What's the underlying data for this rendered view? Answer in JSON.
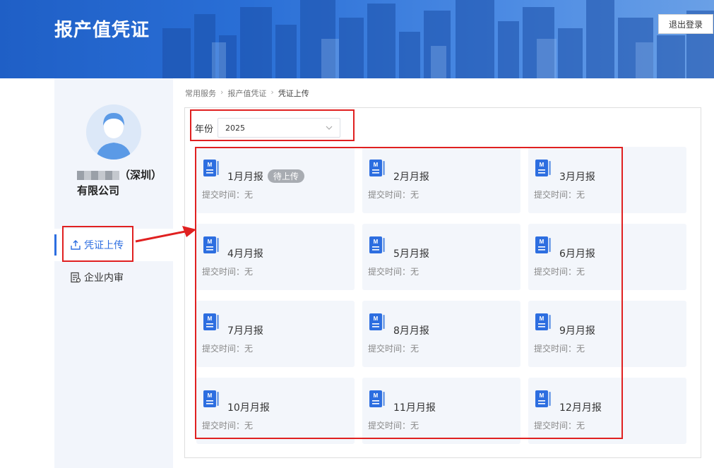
{
  "header": {
    "title": "报产值凭证",
    "logout_label": "退出登录"
  },
  "sidebar": {
    "company_name_suffix": "（深圳）有限公司",
    "items": [
      {
        "label": "凭证上传",
        "icon": "upload-icon",
        "active": true
      },
      {
        "label": "企业内审",
        "icon": "audit-doc-icon",
        "active": false
      }
    ]
  },
  "breadcrumb": [
    "常用服务",
    "报产值凭证",
    "凭证上传"
  ],
  "filter": {
    "year_label": "年份",
    "year_value": "2025"
  },
  "reports": [
    {
      "title": "1月月报",
      "badge": "待上传",
      "time_label": "提交时间：无"
    },
    {
      "title": "2月月报",
      "badge": "",
      "time_label": "提交时间：无"
    },
    {
      "title": "3月月报",
      "badge": "",
      "time_label": "提交时间：无"
    },
    {
      "title": "4月月报",
      "badge": "",
      "time_label": "提交时间：无"
    },
    {
      "title": "5月月报",
      "badge": "",
      "time_label": "提交时间：无"
    },
    {
      "title": "6月月报",
      "badge": "",
      "time_label": "提交时间：无"
    },
    {
      "title": "7月月报",
      "badge": "",
      "time_label": "提交时间：无"
    },
    {
      "title": "8月月报",
      "badge": "",
      "time_label": "提交时间：无"
    },
    {
      "title": "9月月报",
      "badge": "",
      "time_label": "提交时间：无"
    },
    {
      "title": "10月月报",
      "badge": "",
      "time_label": "提交时间：无"
    },
    {
      "title": "11月月报",
      "badge": "",
      "time_label": "提交时间：无"
    },
    {
      "title": "12月月报",
      "badge": "",
      "time_label": "提交时间：无"
    }
  ],
  "colors": {
    "accent": "#2d6ee0",
    "annotation": "#e02020",
    "card_bg": "#f3f6fb"
  }
}
